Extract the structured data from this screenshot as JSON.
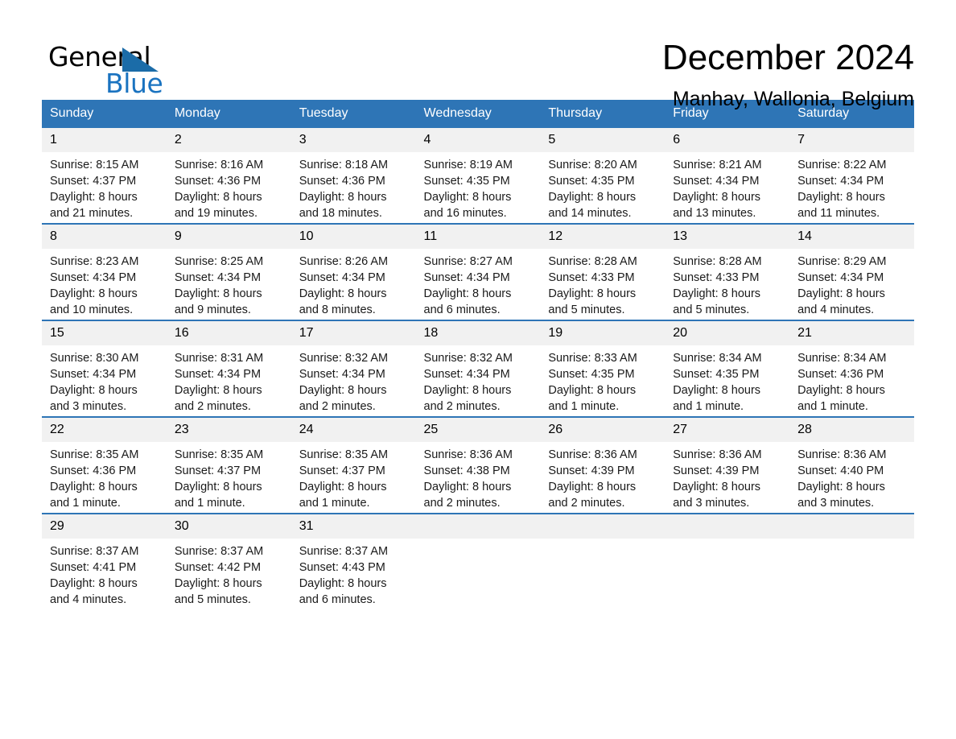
{
  "logo": {
    "word_general": "General",
    "word_blue": "Blue",
    "triangle_color": "#1b6ca8",
    "blue_text_color": "#1a73c0"
  },
  "header": {
    "month_title": "December 2024",
    "location": "Manhay, Wallonia, Belgium"
  },
  "theme": {
    "header_bg": "#2e75b6",
    "header_text": "#ffffff",
    "daynum_bg": "#f1f1f1",
    "row_border": "#2e75b6",
    "cell_bg": "#ffffff"
  },
  "weekdays": [
    "Sunday",
    "Monday",
    "Tuesday",
    "Wednesday",
    "Thursday",
    "Friday",
    "Saturday"
  ],
  "weeks": [
    [
      {
        "day": "1",
        "sunrise": "Sunrise: 8:15 AM",
        "sunset": "Sunset: 4:37 PM",
        "daylight_1": "Daylight: 8 hours",
        "daylight_2": "and 21 minutes."
      },
      {
        "day": "2",
        "sunrise": "Sunrise: 8:16 AM",
        "sunset": "Sunset: 4:36 PM",
        "daylight_1": "Daylight: 8 hours",
        "daylight_2": "and 19 minutes."
      },
      {
        "day": "3",
        "sunrise": "Sunrise: 8:18 AM",
        "sunset": "Sunset: 4:36 PM",
        "daylight_1": "Daylight: 8 hours",
        "daylight_2": "and 18 minutes."
      },
      {
        "day": "4",
        "sunrise": "Sunrise: 8:19 AM",
        "sunset": "Sunset: 4:35 PM",
        "daylight_1": "Daylight: 8 hours",
        "daylight_2": "and 16 minutes."
      },
      {
        "day": "5",
        "sunrise": "Sunrise: 8:20 AM",
        "sunset": "Sunset: 4:35 PM",
        "daylight_1": "Daylight: 8 hours",
        "daylight_2": "and 14 minutes."
      },
      {
        "day": "6",
        "sunrise": "Sunrise: 8:21 AM",
        "sunset": "Sunset: 4:34 PM",
        "daylight_1": "Daylight: 8 hours",
        "daylight_2": "and 13 minutes."
      },
      {
        "day": "7",
        "sunrise": "Sunrise: 8:22 AM",
        "sunset": "Sunset: 4:34 PM",
        "daylight_1": "Daylight: 8 hours",
        "daylight_2": "and 11 minutes."
      }
    ],
    [
      {
        "day": "8",
        "sunrise": "Sunrise: 8:23 AM",
        "sunset": "Sunset: 4:34 PM",
        "daylight_1": "Daylight: 8 hours",
        "daylight_2": "and 10 minutes."
      },
      {
        "day": "9",
        "sunrise": "Sunrise: 8:25 AM",
        "sunset": "Sunset: 4:34 PM",
        "daylight_1": "Daylight: 8 hours",
        "daylight_2": "and 9 minutes."
      },
      {
        "day": "10",
        "sunrise": "Sunrise: 8:26 AM",
        "sunset": "Sunset: 4:34 PM",
        "daylight_1": "Daylight: 8 hours",
        "daylight_2": "and 8 minutes."
      },
      {
        "day": "11",
        "sunrise": "Sunrise: 8:27 AM",
        "sunset": "Sunset: 4:34 PM",
        "daylight_1": "Daylight: 8 hours",
        "daylight_2": "and 6 minutes."
      },
      {
        "day": "12",
        "sunrise": "Sunrise: 8:28 AM",
        "sunset": "Sunset: 4:33 PM",
        "daylight_1": "Daylight: 8 hours",
        "daylight_2": "and 5 minutes."
      },
      {
        "day": "13",
        "sunrise": "Sunrise: 8:28 AM",
        "sunset": "Sunset: 4:33 PM",
        "daylight_1": "Daylight: 8 hours",
        "daylight_2": "and 5 minutes."
      },
      {
        "day": "14",
        "sunrise": "Sunrise: 8:29 AM",
        "sunset": "Sunset: 4:34 PM",
        "daylight_1": "Daylight: 8 hours",
        "daylight_2": "and 4 minutes."
      }
    ],
    [
      {
        "day": "15",
        "sunrise": "Sunrise: 8:30 AM",
        "sunset": "Sunset: 4:34 PM",
        "daylight_1": "Daylight: 8 hours",
        "daylight_2": "and 3 minutes."
      },
      {
        "day": "16",
        "sunrise": "Sunrise: 8:31 AM",
        "sunset": "Sunset: 4:34 PM",
        "daylight_1": "Daylight: 8 hours",
        "daylight_2": "and 2 minutes."
      },
      {
        "day": "17",
        "sunrise": "Sunrise: 8:32 AM",
        "sunset": "Sunset: 4:34 PM",
        "daylight_1": "Daylight: 8 hours",
        "daylight_2": "and 2 minutes."
      },
      {
        "day": "18",
        "sunrise": "Sunrise: 8:32 AM",
        "sunset": "Sunset: 4:34 PM",
        "daylight_1": "Daylight: 8 hours",
        "daylight_2": "and 2 minutes."
      },
      {
        "day": "19",
        "sunrise": "Sunrise: 8:33 AM",
        "sunset": "Sunset: 4:35 PM",
        "daylight_1": "Daylight: 8 hours",
        "daylight_2": "and 1 minute."
      },
      {
        "day": "20",
        "sunrise": "Sunrise: 8:34 AM",
        "sunset": "Sunset: 4:35 PM",
        "daylight_1": "Daylight: 8 hours",
        "daylight_2": "and 1 minute."
      },
      {
        "day": "21",
        "sunrise": "Sunrise: 8:34 AM",
        "sunset": "Sunset: 4:36 PM",
        "daylight_1": "Daylight: 8 hours",
        "daylight_2": "and 1 minute."
      }
    ],
    [
      {
        "day": "22",
        "sunrise": "Sunrise: 8:35 AM",
        "sunset": "Sunset: 4:36 PM",
        "daylight_1": "Daylight: 8 hours",
        "daylight_2": "and 1 minute."
      },
      {
        "day": "23",
        "sunrise": "Sunrise: 8:35 AM",
        "sunset": "Sunset: 4:37 PM",
        "daylight_1": "Daylight: 8 hours",
        "daylight_2": "and 1 minute."
      },
      {
        "day": "24",
        "sunrise": "Sunrise: 8:35 AM",
        "sunset": "Sunset: 4:37 PM",
        "daylight_1": "Daylight: 8 hours",
        "daylight_2": "and 1 minute."
      },
      {
        "day": "25",
        "sunrise": "Sunrise: 8:36 AM",
        "sunset": "Sunset: 4:38 PM",
        "daylight_1": "Daylight: 8 hours",
        "daylight_2": "and 2 minutes."
      },
      {
        "day": "26",
        "sunrise": "Sunrise: 8:36 AM",
        "sunset": "Sunset: 4:39 PM",
        "daylight_1": "Daylight: 8 hours",
        "daylight_2": "and 2 minutes."
      },
      {
        "day": "27",
        "sunrise": "Sunrise: 8:36 AM",
        "sunset": "Sunset: 4:39 PM",
        "daylight_1": "Daylight: 8 hours",
        "daylight_2": "and 3 minutes."
      },
      {
        "day": "28",
        "sunrise": "Sunrise: 8:36 AM",
        "sunset": "Sunset: 4:40 PM",
        "daylight_1": "Daylight: 8 hours",
        "daylight_2": "and 3 minutes."
      }
    ],
    [
      {
        "day": "29",
        "sunrise": "Sunrise: 8:37 AM",
        "sunset": "Sunset: 4:41 PM",
        "daylight_1": "Daylight: 8 hours",
        "daylight_2": "and 4 minutes."
      },
      {
        "day": "30",
        "sunrise": "Sunrise: 8:37 AM",
        "sunset": "Sunset: 4:42 PM",
        "daylight_1": "Daylight: 8 hours",
        "daylight_2": "and 5 minutes."
      },
      {
        "day": "31",
        "sunrise": "Sunrise: 8:37 AM",
        "sunset": "Sunset: 4:43 PM",
        "daylight_1": "Daylight: 8 hours",
        "daylight_2": "and 6 minutes."
      },
      {
        "day": "",
        "sunrise": "",
        "sunset": "",
        "daylight_1": "",
        "daylight_2": ""
      },
      {
        "day": "",
        "sunrise": "",
        "sunset": "",
        "daylight_1": "",
        "daylight_2": ""
      },
      {
        "day": "",
        "sunrise": "",
        "sunset": "",
        "daylight_1": "",
        "daylight_2": ""
      },
      {
        "day": "",
        "sunrise": "",
        "sunset": "",
        "daylight_1": "",
        "daylight_2": ""
      }
    ]
  ]
}
